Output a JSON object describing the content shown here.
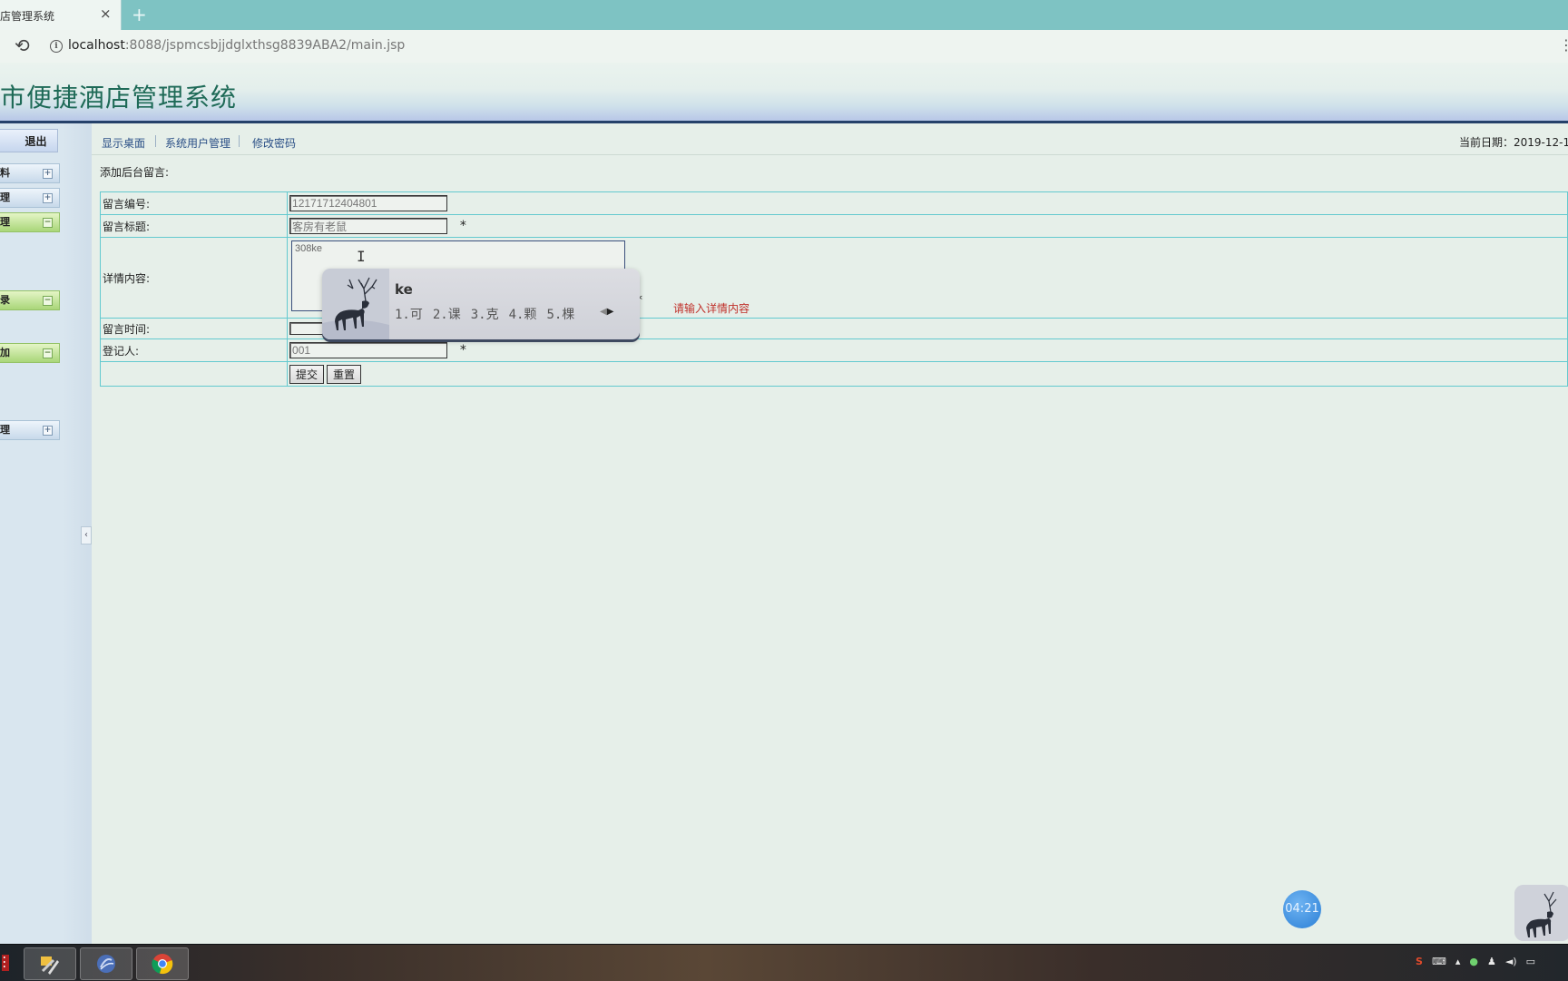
{
  "browser": {
    "tab_title": "店管理系统",
    "tab_close": "×",
    "new_tab": "+",
    "url_host": "localhost",
    "url_rest": ":8088/jspmcsbjjdglxthsg8839ABA2/main.jsp"
  },
  "header": {
    "title": "市便捷酒店管理系统"
  },
  "sidebar": {
    "logout": "退出",
    "menus": [
      {
        "label": "料",
        "state": "+",
        "style": "blue"
      },
      {
        "label": "理",
        "state": "+",
        "style": "blue"
      },
      {
        "label": "理",
        "state": "−",
        "style": "green"
      },
      {
        "label": "录",
        "state": "−",
        "style": "green"
      },
      {
        "label": "加",
        "state": "−",
        "style": "green"
      },
      {
        "label": "理",
        "state": "+",
        "style": "blue"
      }
    ],
    "collapse": "‹"
  },
  "nav": {
    "links": [
      "显示桌面",
      "系统用户管理",
      "修改密码"
    ],
    "date_label": "当前日期：2019-12-1"
  },
  "form": {
    "section_title": "添加后台留言:",
    "fields": {
      "id_label": "留言编号:",
      "id_value": "12171712404801",
      "title_label": "留言标题:",
      "title_value": "客房有老鼠",
      "content_label": "详情内容:",
      "content_value": "308ke",
      "content_error": "请输入详情内容",
      "time_label": "留言时间:",
      "time_value": "",
      "user_label": "登记人:",
      "user_value": "001"
    },
    "required_mark": "*",
    "submit": "提交",
    "reset": "重置"
  },
  "ime": {
    "pinyin": "ke",
    "candidates": [
      "1.可",
      "2.课",
      "3.克",
      "4.颗",
      "5.棵"
    ]
  },
  "timer": "04:21",
  "colors": {
    "header_title": "#1e6a57",
    "table_border": "#63c9cf",
    "error_text": "#c0312b",
    "nav_link": "#2a4f86",
    "tabstrip": "#7ec3c3"
  }
}
